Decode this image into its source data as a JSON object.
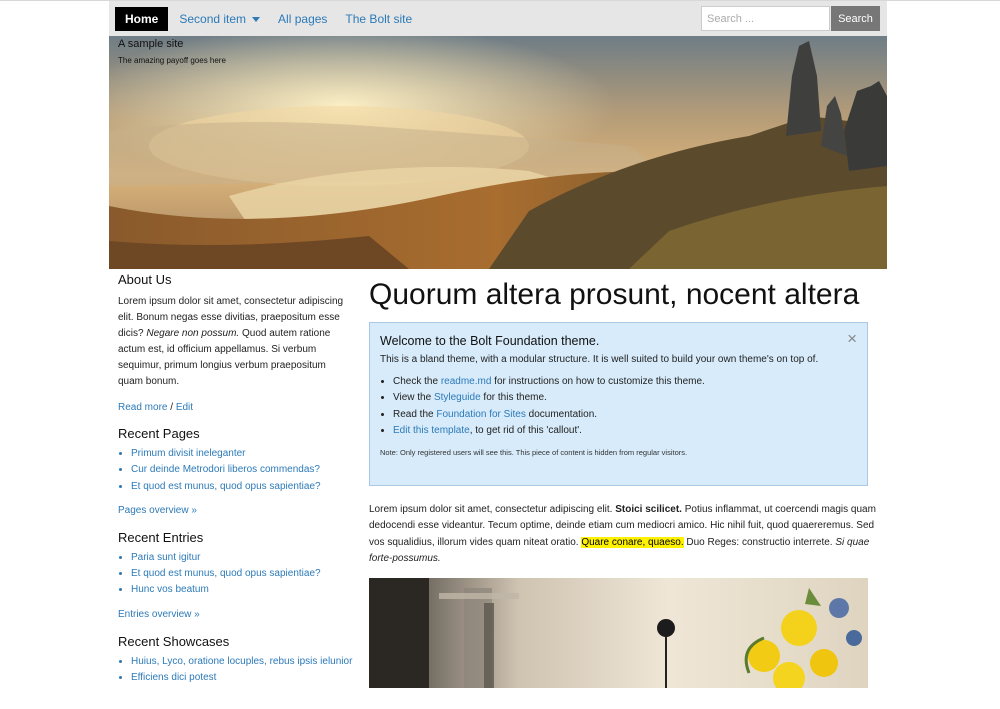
{
  "nav": {
    "home": "Home",
    "second_item": "Second item",
    "all_pages": "All pages",
    "bolt_site": "The Bolt site",
    "search_placeholder": "Search ...",
    "search_button": "Search"
  },
  "hero": {
    "site_title": "A sample site",
    "payoff": "The amazing payoff goes here"
  },
  "sidebar": {
    "about": {
      "heading": "About Us",
      "text_1": "Lorem ipsum dolor sit amet, consectetur adipiscing elit. Bonum negas esse divitias, praepositum esse dicis? ",
      "text_em": "Negare non possum.",
      "text_2": " Quod autem ratione actum est, id officium appellamus. Si verbum sequimur, primum longius verbum praepositum quam bonum.",
      "read_more": "Read more",
      "separator": " / ",
      "edit": "Edit"
    },
    "recent_pages": {
      "heading": "Recent Pages",
      "items": [
        "Primum divisit ineleganter",
        "Cur deinde Metrodori liberos commendas?",
        "Et quod est munus, quod opus sapientiae?"
      ],
      "overview": "Pages overview »"
    },
    "recent_entries": {
      "heading": "Recent Entries",
      "items": [
        "Paria sunt igitur",
        "Et quod est munus, quod opus sapientiae?",
        "Hunc vos beatum"
      ],
      "overview": "Entries overview »"
    },
    "recent_showcases": {
      "heading": "Recent Showcases",
      "items": [
        "Huius, Lyco, oratione locuples, rebus ipsis ielunior",
        "Efficiens dici potest"
      ]
    }
  },
  "main": {
    "title": "Quorum altera prosunt, nocent altera",
    "callout": {
      "heading": "Welcome to the Bolt Foundation theme.",
      "text": "This is a bland theme, with a modular structure. It is well suited to build your own theme's on top of.",
      "items": [
        {
          "pre": "Check the ",
          "link": "readme.md",
          "post": " for instructions on how to customize this theme."
        },
        {
          "pre": "View the ",
          "link": "Styleguide",
          "post": " for this theme."
        },
        {
          "pre": "Read the ",
          "link": "Foundation for Sites",
          "post": " documentation."
        },
        {
          "pre": "",
          "link": "Edit this template",
          "post": ", to get rid of this 'callout'."
        }
      ],
      "note": "Note: Only registered users will see this. This piece of content is hidden from regular visitors.",
      "close": "×"
    },
    "body": {
      "t1": "Lorem ipsum dolor sit amet, consectetur adipiscing elit. ",
      "strong": "Stoici scilicet.",
      "t2": " Potius inflammat, ut coercendi magis quam dedocendi esse videantur. Tecum optime, deinde etiam cum mediocri amico. Hic nihil fuit, quod quaereremus. Sed vos squalidius, illorum vides quam niteat oratio. ",
      "mark": "Quare conare, quaeso.",
      "t3": " Duo Reges: constructio interrete. ",
      "em": "Si quae forte-possumus."
    }
  }
}
